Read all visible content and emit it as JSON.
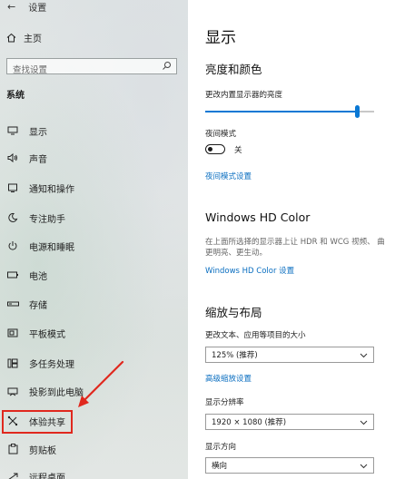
{
  "window": {
    "back_glyph": "←",
    "title": "设置"
  },
  "sidebar": {
    "home_label": "主页",
    "search_placeholder": "查找设置",
    "section_title": "系统",
    "items": [
      {
        "label": "显示",
        "icon": "monitor-icon"
      },
      {
        "label": "声音",
        "icon": "speaker-icon"
      },
      {
        "label": "通知和操作",
        "icon": "notification-icon"
      },
      {
        "label": "专注助手",
        "icon": "moon-icon"
      },
      {
        "label": "电源和睡眠",
        "icon": "power-icon"
      },
      {
        "label": "电池",
        "icon": "battery-icon"
      },
      {
        "label": "存储",
        "icon": "storage-icon"
      },
      {
        "label": "平板模式",
        "icon": "tablet-mode-icon"
      },
      {
        "label": "多任务处理",
        "icon": "multitask-icon"
      },
      {
        "label": "投影到此电脑",
        "icon": "project-icon"
      },
      {
        "label": "体验共享",
        "icon": "shared-experiences-icon",
        "highlighted": true
      },
      {
        "label": "剪贴板",
        "icon": "clipboard-icon"
      },
      {
        "label": "远程桌面",
        "icon": "remote-desktop-icon"
      }
    ],
    "annotation_color": "#e0281e"
  },
  "main": {
    "page_title": "显示",
    "brightness": {
      "heading": "亮度和颜色",
      "slider_label": "更改内置显示器的亮度",
      "slider_value_fraction": 0.9
    },
    "night_light": {
      "label": "夜间模式",
      "state": "关",
      "settings_link": "夜间模式设置"
    },
    "hd_color": {
      "heading": "Windows HD Color",
      "description": "在上面所选择的显示器上让 HDR 和 WCG 视频、 曲更明亮、更生动。",
      "settings_link": "Windows HD Color 设置"
    },
    "scale_layout": {
      "heading": "缩放与布局",
      "scale_label": "更改文本、应用等项目的大小",
      "scale_value": "125% (推荐)",
      "advanced_link": "高级缩放设置",
      "resolution_label": "显示分辨率",
      "resolution_value": "1920 × 1080 (推荐)",
      "orientation_label": "显示方向",
      "orientation_value": "横向"
    },
    "accent_color": "#0a78d4",
    "link_color": "#0a6ec0"
  }
}
